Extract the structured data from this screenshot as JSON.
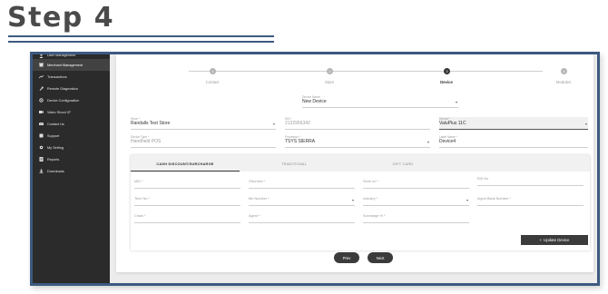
{
  "page_heading": "Step 4",
  "sidebar": {
    "items": [
      {
        "label": "User Management",
        "icon": "user-icon"
      },
      {
        "label": "Merchant Management",
        "icon": "store-icon",
        "active": true
      },
      {
        "label": "Transactions",
        "icon": "trend-icon"
      },
      {
        "label": "Remote Diagnostics",
        "icon": "wrench-icon"
      },
      {
        "label": "Device Configuration",
        "icon": "gear-icon"
      },
      {
        "label": "Video Shoot IIT",
        "icon": "video-icon"
      },
      {
        "label": "Contact Us",
        "icon": "envelope-icon"
      },
      {
        "label": "Support",
        "icon": "support-icon"
      },
      {
        "label": "My Setting",
        "icon": "setting-icon"
      },
      {
        "label": "Reports",
        "icon": "report-icon"
      },
      {
        "label": "Downloads",
        "icon": "download-icon"
      }
    ]
  },
  "stepper": {
    "steps": [
      {
        "number": "1",
        "label": "Contact"
      },
      {
        "number": "2",
        "label": "Store"
      },
      {
        "number": "3",
        "label": "Device",
        "active": true
      },
      {
        "number": "4",
        "label": "Modules"
      }
    ]
  },
  "form": {
    "device_name": {
      "label": "Device Name",
      "value": "New Device"
    },
    "store": {
      "label": "Store *",
      "value": "Randalls Test Store"
    },
    "eid": {
      "label": "EID *",
      "value": "2132956342"
    },
    "device": {
      "label": "Device*",
      "value": "ValuPlus 11C"
    },
    "device_type": {
      "label": "Device Type *",
      "value": "Handheld POS"
    },
    "processor": {
      "label": "Processor *",
      "value": "TSYS SIERRA"
    },
    "label_name": {
      "label": "Label Name *",
      "value": "Device4"
    }
  },
  "tabs": {
    "items": [
      "CASH DISCOUNT/SURCHARGE",
      "TRADITIONAL",
      "GIFT CARD"
    ],
    "active_index": 0
  },
  "tab_fields": {
    "row1": [
      "MID *",
      "VNumber *",
      "Store no *",
      "EDI No"
    ],
    "row2": [
      "Term No *",
      "Bin Number *",
      "Industry *",
      "Agent Bank Number *"
    ],
    "row3": [
      "Chain *",
      "Agent *",
      "Surcharge % *"
    ]
  },
  "buttons": {
    "update_device": "Update Device",
    "update_icon": "plus-icon",
    "prev": "Prev",
    "next": "Next"
  },
  "colors": {
    "frame_border": "#3d5a80",
    "sidebar_bg": "#2b2b2b",
    "active_step": "#333333",
    "button_dark": "#3b3b3b"
  }
}
